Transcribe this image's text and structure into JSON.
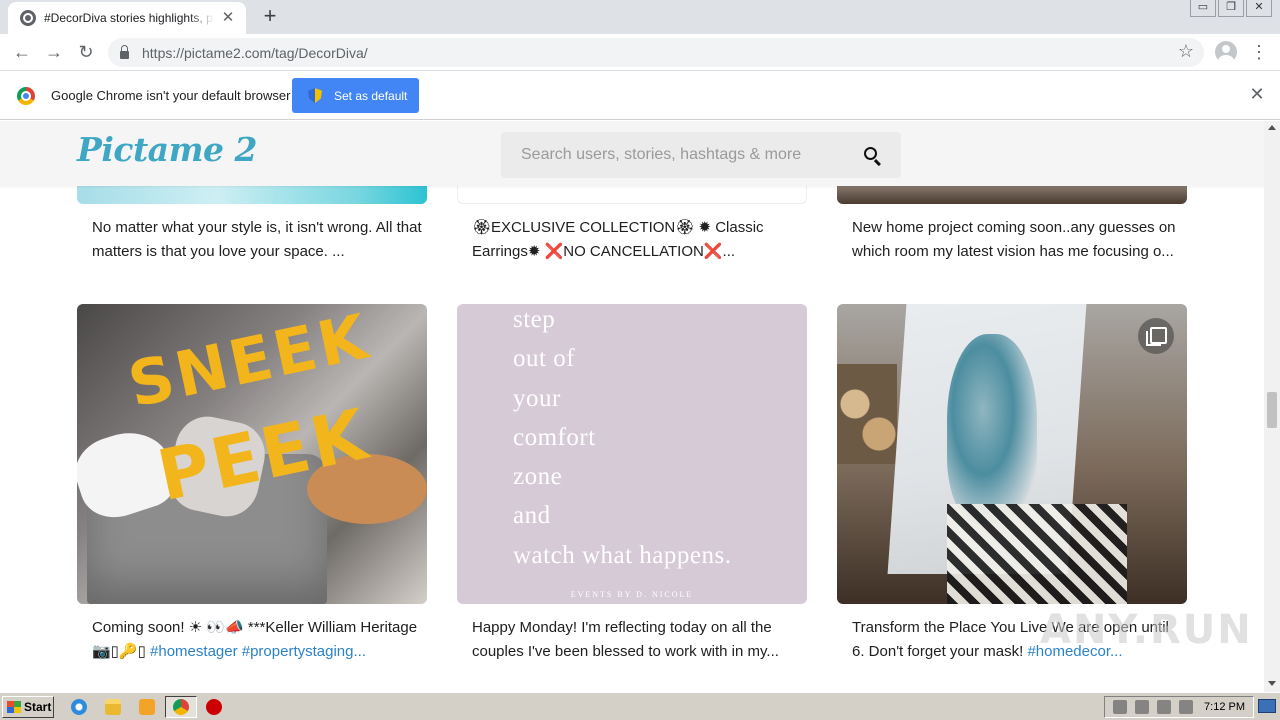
{
  "browser": {
    "tab_title": "#DecorDiva stories highlights, photos",
    "url_domain": "https://pictame2.com",
    "url_path": "/tag/DecorDiva/",
    "infobar_text": "Google Chrome isn't your default browser",
    "set_default_label": "Set as default"
  },
  "site": {
    "logo": "Pictame 2",
    "search_placeholder": "Search users, stories, hashtags & more"
  },
  "posts_row1": [
    {
      "caption": "No matter what your style is, it isn't wrong. All that matters is that you love your space.                 ..."
    },
    {
      "caption": "🏵EXCLUSIVE COLLECTION🏵 ✹ Classic Earrings✹ ❌NO CANCELLATION❌..."
    },
    {
      "caption": "New home project coming soon..any guesses on which room my latest vision has me focusing o..."
    }
  ],
  "posts_row2": [
    {
      "caption_text": "Coming soon! ☀ 👀📣 ***Keller William Heritage 📷▯🔑▯ ",
      "caption_tags": "#homestager #propertystaging...",
      "image_text_line1": "SNEEK",
      "image_text_line2": "PEEK"
    },
    {
      "caption": "Happy Monday!       I'm reflecting today on all the couples I've been blessed to work with in my...",
      "quote_lines": [
        "step",
        "out of",
        "your",
        "comfort",
        "zone",
        "and",
        "watch what happens."
      ],
      "quote_footer": "EVENTS BY D. NICOLE"
    },
    {
      "caption_text": "Transform the Place You Live We are open until 6. Don't forget your mask! ",
      "caption_tags": "#homedecor..."
    }
  ],
  "watermark": "ANY.RUN",
  "taskbar": {
    "start_label": "Start",
    "clock": "7:12 PM"
  },
  "icons": {
    "tab": "tab-favicon-icon",
    "search": "search-icon",
    "gallery": "multiple-images-icon",
    "lock": "lock-icon"
  }
}
